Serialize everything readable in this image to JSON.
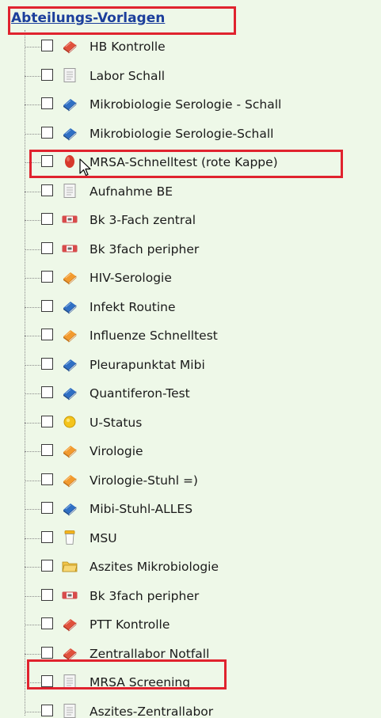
{
  "tree": {
    "header": "Abteilungs-Vorlagen",
    "items": [
      {
        "label": "HB Kontrolle",
        "icon": "red-book-icon"
      },
      {
        "label": "Labor Schall",
        "icon": "document-icon"
      },
      {
        "label": "Mikrobiologie Serologie - Schall",
        "icon": "blue-book-icon"
      },
      {
        "label": "Mikrobiologie Serologie-Schall",
        "icon": "blue-book-icon"
      },
      {
        "label": "MRSA-Schnelltest (rote Kappe)",
        "icon": "red-cap-icon"
      },
      {
        "label": "Aufnahme BE",
        "icon": "document-icon"
      },
      {
        "label": "Bk 3-Fach zentral",
        "icon": "tube-label-icon"
      },
      {
        "label": "Bk 3fach peripher",
        "icon": "tube-label-icon"
      },
      {
        "label": "HIV-Serologie",
        "icon": "orange-book-icon"
      },
      {
        "label": "Infekt Routine",
        "icon": "blue-book-icon"
      },
      {
        "label": "Influenze Schnelltest",
        "icon": "orange-book-icon"
      },
      {
        "label": "Pleurapunktat Mibi",
        "icon": "blue-book-icon"
      },
      {
        "label": "Quantiferon-Test",
        "icon": "blue-book-icon"
      },
      {
        "label": "U-Status",
        "icon": "yellow-circle-icon"
      },
      {
        "label": "Virologie",
        "icon": "orange-book-icon"
      },
      {
        "label": "Virologie-Stuhl =)",
        "icon": "orange-book-icon"
      },
      {
        "label": "Mibi-Stuhl-ALLES",
        "icon": "blue-book-icon"
      },
      {
        "label": "MSU",
        "icon": "urine-cup-icon"
      },
      {
        "label": "Aszites Mikrobiologie",
        "icon": "folder-icon"
      },
      {
        "label": "Bk 3fach peripher",
        "icon": "tube-label-icon"
      },
      {
        "label": "PTT Kontrolle",
        "icon": "red-book-icon"
      },
      {
        "label": "Zentrallabor Notfall",
        "icon": "red-book-icon"
      },
      {
        "label": "MRSA Screening",
        "icon": "document-icon"
      },
      {
        "label": "Aszites-Zentrallabor",
        "icon": "document-icon"
      }
    ]
  },
  "colors": {
    "background": "#eef8e8",
    "header_link": "#1c3f9c",
    "highlight": "#e0232e"
  }
}
